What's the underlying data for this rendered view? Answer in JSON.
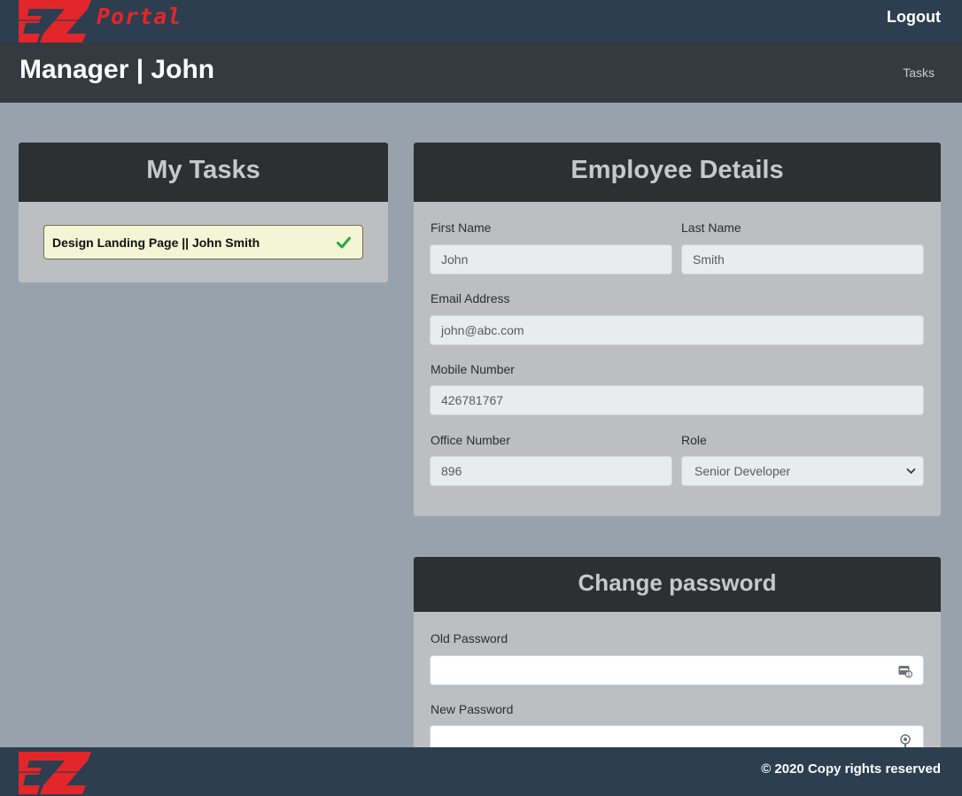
{
  "brand": {
    "logo_mark": "EZ",
    "name": "Portal",
    "accent_color": "#e3262a"
  },
  "nav": {
    "logout_label": "Logout"
  },
  "header": {
    "title": "Manager | John",
    "breadcrumb": "Tasks"
  },
  "tasks": {
    "title": "My Tasks",
    "items": [
      {
        "label": "Design Landing Page || John Smith",
        "status_icon": "check-icon",
        "status_color": "#28a745"
      }
    ]
  },
  "employee_details": {
    "title": "Employee Details",
    "first_name": {
      "label": "First Name",
      "value": "John"
    },
    "last_name": {
      "label": "Last Name",
      "value": "Smith"
    },
    "email": {
      "label": "Email Address",
      "value": "john@abc.com"
    },
    "mobile": {
      "label": "Mobile Number",
      "value": "426781767"
    },
    "office": {
      "label": "Office Number",
      "value": "896"
    },
    "role": {
      "label": "Role",
      "value": "Senior Developer"
    }
  },
  "change_password": {
    "title": "Change password",
    "old_password": {
      "label": "Old Password",
      "value": ""
    },
    "new_password": {
      "label": "New Password",
      "value": ""
    }
  },
  "footer": {
    "copyright": "© 2020 Copy rights reserved"
  }
}
